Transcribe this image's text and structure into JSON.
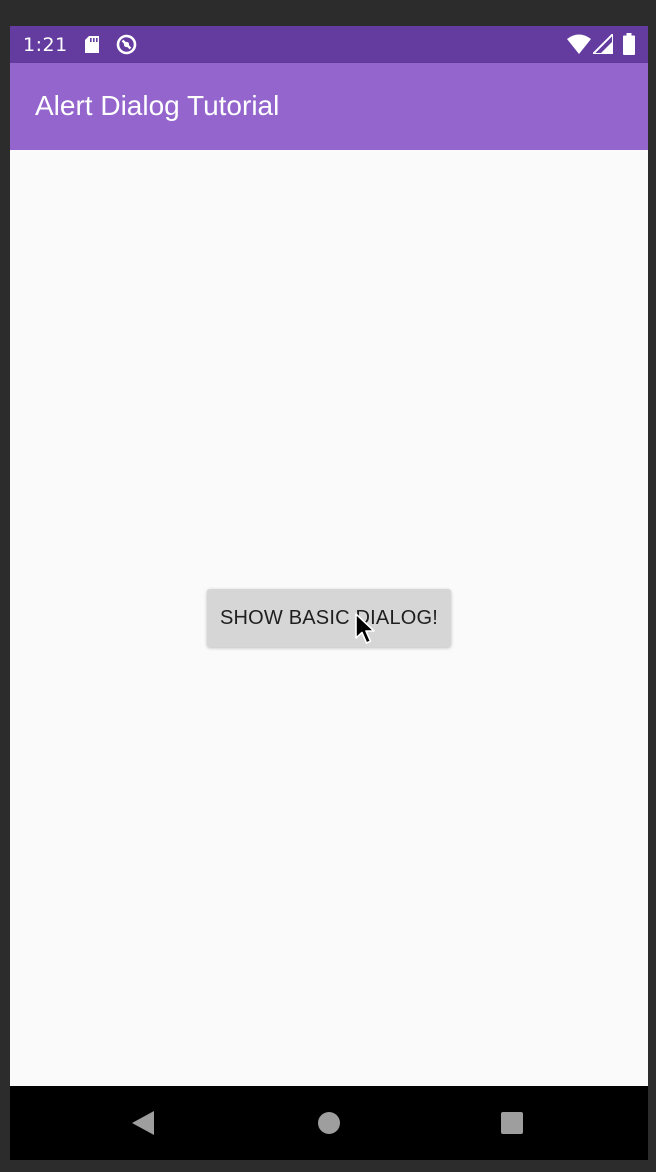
{
  "status_bar": {
    "time": "1:21",
    "icons": [
      "sd-card-icon",
      "sync-icon",
      "wifi-icon",
      "signal-icon",
      "battery-icon"
    ]
  },
  "app_bar": {
    "title": "Alert Dialog Tutorial"
  },
  "main": {
    "show_dialog_button_label": "SHOW BASIC DIALOG!"
  },
  "nav_bar": {
    "icons": [
      "back-icon",
      "home-icon",
      "recents-icon"
    ]
  },
  "colors": {
    "status_bar": "#643b9f",
    "app_bar": "#9365cd",
    "content_background": "#fafafa",
    "button_background": "#d6d6d6",
    "nav_bar": "#000000"
  }
}
